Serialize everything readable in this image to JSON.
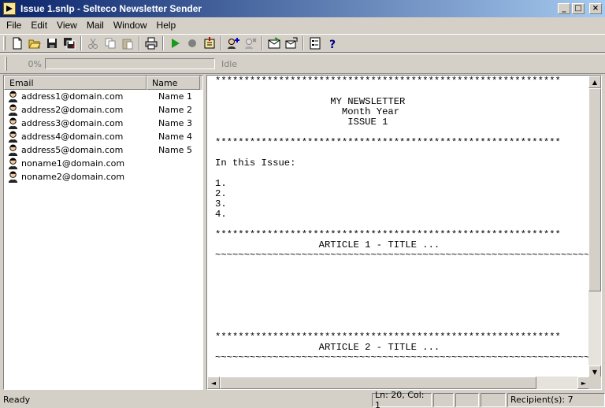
{
  "window": {
    "title": "Issue 1.snlp - Selteco Newsletter Sender",
    "minimize": "_",
    "maximize": "□",
    "close": "×"
  },
  "menu": [
    "File",
    "Edit",
    "View",
    "Mail",
    "Window",
    "Help"
  ],
  "toolbar": {
    "icons": [
      "new-file-icon",
      "open-folder-icon",
      "save-icon",
      "save-all-icon",
      "cut-icon",
      "copy-icon",
      "paste-icon",
      "print-icon",
      "play-icon",
      "stop-icon",
      "import-icon",
      "add-recipient-icon",
      "remove-recipient-icon",
      "send-mail-icon",
      "mail-settings-icon",
      "properties-icon",
      "help-icon"
    ]
  },
  "progress": {
    "percent_label": "0%",
    "value": 0,
    "status": "Idle"
  },
  "recipients": {
    "columns": [
      "Email",
      "Name"
    ],
    "rows": [
      {
        "email": "address1@domain.com",
        "name": "Name 1"
      },
      {
        "email": "address2@domain.com",
        "name": "Name 2"
      },
      {
        "email": "address3@domain.com",
        "name": "Name 3"
      },
      {
        "email": "address4@domain.com",
        "name": "Name 4"
      },
      {
        "email": "address5@domain.com",
        "name": "Name 5"
      },
      {
        "email": "noname1@domain.com",
        "name": ""
      },
      {
        "email": "noname2@domain.com",
        "name": ""
      }
    ]
  },
  "editor": {
    "lines": [
      "************************************************************",
      "",
      "                    MY NEWSLETTER",
      "                      Month Year",
      "                       ISSUE 1",
      "",
      "************************************************************",
      "",
      "In this Issue:",
      "",
      "1.",
      "2.",
      "3.",
      "4.",
      "",
      "************************************************************",
      "                  ARTICLE 1 - TITLE ...",
      "~~~~~~~~~~~~~~~~~~~~~~~~~~~~~~~~~~~~~~~~~~~~~~~~~~~~~~~~~~~~~~~~~~~~~~~~~~~~~~~~~~",
      "",
      "",
      "",
      "",
      "",
      "",
      "",
      "************************************************************",
      "                  ARTICLE 2 - TITLE ...",
      "~~~~~~~~~~~~~~~~~~~~~~~~~~~~~~~~~~~~~~~~~~~~~~~~~~~~~~~~~~~~~~~~~~~~~~~~~~~~~~~~~~"
    ]
  },
  "status": {
    "ready": "Ready",
    "position": "Ln: 20, Col: 1",
    "recipients": "Recipient(s): 7"
  }
}
